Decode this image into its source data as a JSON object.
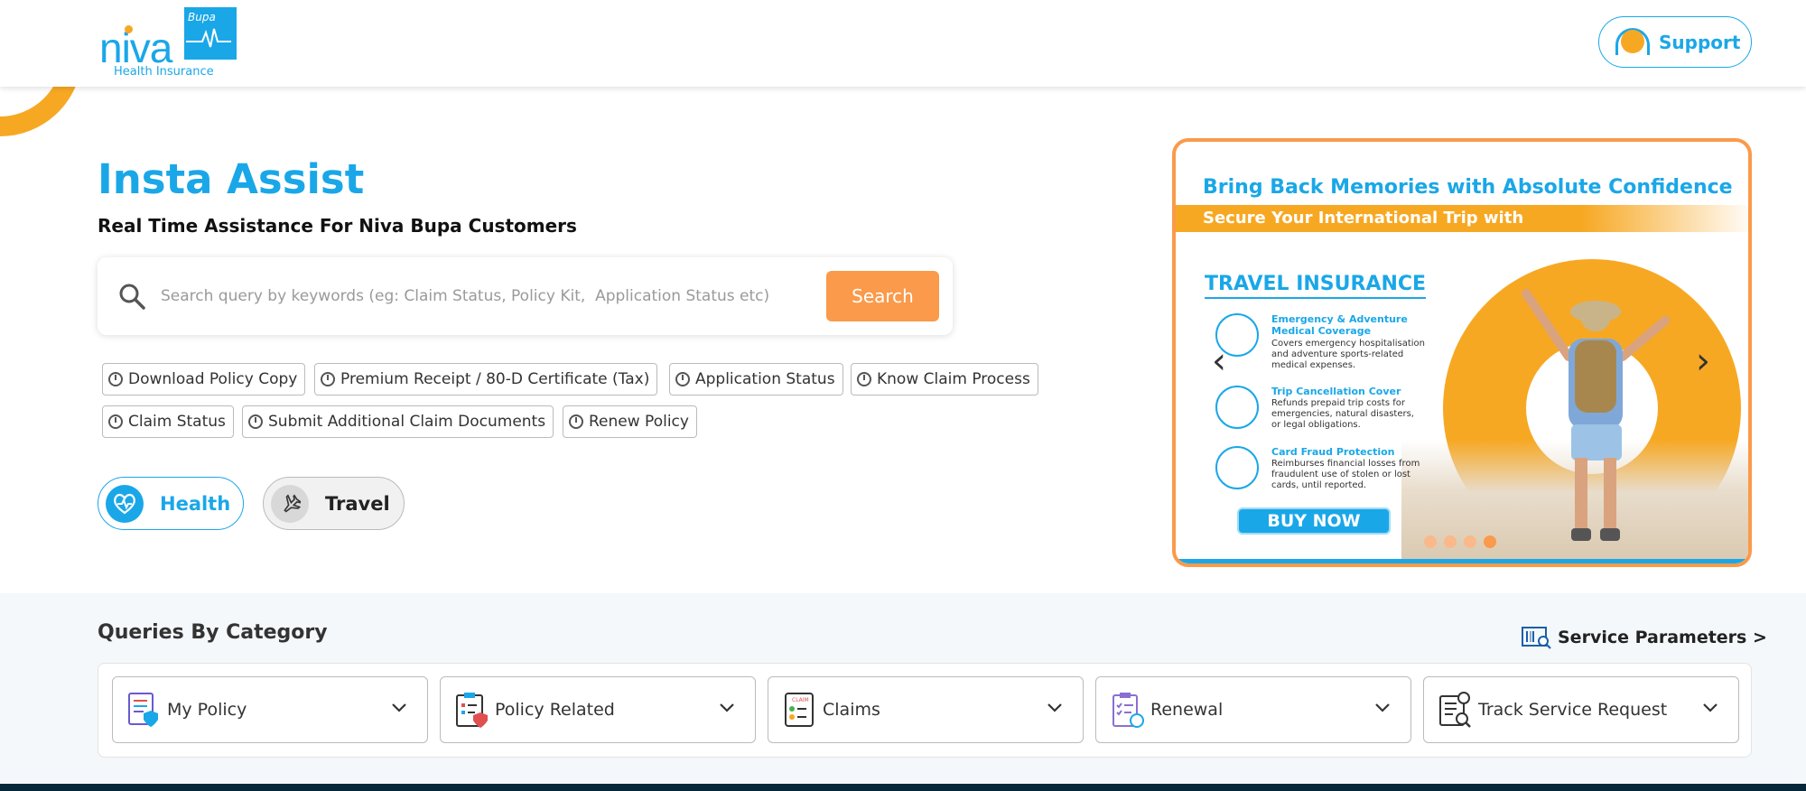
{
  "header": {
    "logo": {
      "brand": "niva",
      "partner": "Bupa",
      "tagline": "Health Insurance"
    },
    "support_label": "Support"
  },
  "hero": {
    "title": "Insta Assist",
    "subtitle": "Real Time Assistance For Niva Bupa Customers",
    "search": {
      "placeholder": "Search query by keywords (eg: Claim Status, Policy Kit,  Application Status etc)",
      "value": "",
      "button_label": "Search"
    },
    "quick_links": [
      "Download Policy Copy",
      "Premium Receipt / 80-D Certificate (Tax)",
      "Application Status",
      "Know Claim Process",
      "Claim Status",
      "Submit Additional Claim Documents",
      "Renew Policy"
    ],
    "toggles": [
      {
        "label": "Health",
        "icon": "heart-pulse-icon",
        "active": true
      },
      {
        "label": "Travel",
        "icon": "airplane-icon",
        "active": false
      }
    ]
  },
  "banner": {
    "headline": "Bring Back Memories with Absolute Confidence",
    "subheadline": "Secure Your International Trip with",
    "product": "TRAVEL INSURANCE",
    "features": [
      {
        "title": "Emergency & Adventure Medical Coverage",
        "desc": "Covers emergency hospitalisation and adventure sports-related medical expenses."
      },
      {
        "title": "Trip Cancellation Cover",
        "desc": "Refunds prepaid trip costs for emergencies, natural disasters, or legal obligations."
      },
      {
        "title": "Card Fraud Protection",
        "desc": "Reimburses financial losses from fraudulent use of stolen or lost cards, until reported."
      }
    ],
    "cta": "BUY NOW",
    "slides_total": 4,
    "slide_active": 4
  },
  "categories": {
    "title": "Queries By Category",
    "service_params_label": "Service Parameters >",
    "items": [
      {
        "label": "My Policy",
        "icon": "policy-document-icon"
      },
      {
        "label": "Policy Related",
        "icon": "clipboard-shield-icon"
      },
      {
        "label": "Claims",
        "icon": "claim-form-icon"
      },
      {
        "label": "Renewal",
        "icon": "renewal-checklist-icon"
      },
      {
        "label": "Track Service Request",
        "icon": "track-request-icon"
      }
    ]
  },
  "colors": {
    "primary": "#1aa7e8",
    "accent": "#fa9a4a",
    "yellow": "#f7a823",
    "footer": "#06273a"
  }
}
